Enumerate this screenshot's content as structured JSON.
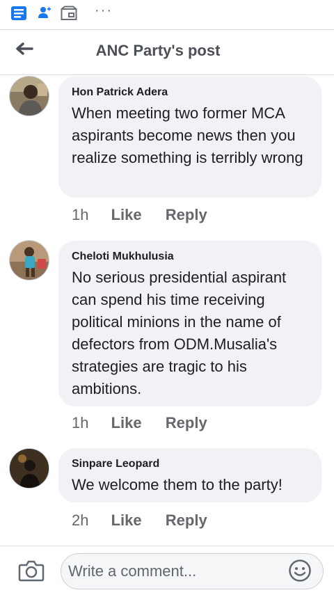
{
  "header": {
    "title": "ANC Party's post",
    "back_icon": "back-arrow-icon"
  },
  "topbar": {
    "icons": [
      "feed-icon",
      "friend-requests-icon",
      "marketplace-icon"
    ],
    "more": "···"
  },
  "colors": {
    "accent": "#1877f2",
    "bubble": "#f0f2f5",
    "muted": "#65676b"
  },
  "comments": [
    {
      "author": "Hon Patrick Adera",
      "text": "When meeting two former MCA aspirants become news then you realize something is terribly wrong",
      "time": "1h",
      "like": "Like",
      "reply": "Reply"
    },
    {
      "author": "Cheloti Mukhulusia",
      "text": "No serious presidential aspirant can spend his time receiving political minions in the name of defectors from ODM.Musalia's strategies are tragic to his ambitions.",
      "time": "1h",
      "like": "Like",
      "reply": "Reply"
    },
    {
      "author": "Sinpare Leopard",
      "text": "We welcome them to the party!",
      "time": "2h",
      "like": "Like",
      "reply": "Reply"
    }
  ],
  "composer": {
    "placeholder": "Write a comment...",
    "camera_icon": "camera-icon",
    "emoji_icon": "emoji-icon"
  }
}
